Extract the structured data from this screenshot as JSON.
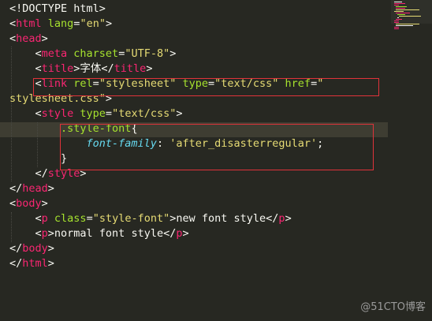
{
  "editor": {
    "lines": [
      [
        {
          "c": "p",
          "t": "<!DOCTYPE html>"
        }
      ],
      [
        {
          "c": "p",
          "t": "<"
        },
        {
          "c": "t",
          "t": "html"
        },
        {
          "c": "a",
          "t": " lang"
        },
        {
          "c": "p",
          "t": "="
        },
        {
          "c": "s",
          "t": "\"en\""
        },
        {
          "c": "p",
          "t": ">"
        }
      ],
      [
        {
          "c": "p",
          "t": "<"
        },
        {
          "c": "t",
          "t": "head"
        },
        {
          "c": "p",
          "t": ">"
        }
      ],
      [
        {
          "c": "p",
          "t": "    <"
        },
        {
          "c": "t",
          "t": "meta"
        },
        {
          "c": "a",
          "t": " charset"
        },
        {
          "c": "p",
          "t": "="
        },
        {
          "c": "s",
          "t": "\"UTF-8\""
        },
        {
          "c": "p",
          "t": ">"
        }
      ],
      [
        {
          "c": "p",
          "t": "    <"
        },
        {
          "c": "t",
          "t": "title"
        },
        {
          "c": "p",
          "t": ">字体</"
        },
        {
          "c": "t",
          "t": "title"
        },
        {
          "c": "p",
          "t": ">"
        }
      ],
      [
        {
          "c": "p",
          "t": "    <"
        },
        {
          "c": "t",
          "t": "link"
        },
        {
          "c": "a",
          "t": " rel"
        },
        {
          "c": "p",
          "t": "="
        },
        {
          "c": "s",
          "t": "\"stylesheet\""
        },
        {
          "c": "a",
          "t": " type"
        },
        {
          "c": "p",
          "t": "="
        },
        {
          "c": "s",
          "t": "\"text/css\""
        },
        {
          "c": "a",
          "t": " href"
        },
        {
          "c": "p",
          "t": "="
        },
        {
          "c": "s",
          "t": "\""
        }
      ],
      [
        {
          "c": "s",
          "t": "stylesheet.css\""
        },
        {
          "c": "p",
          "t": ">"
        }
      ],
      [
        {
          "c": "p",
          "t": "    <"
        },
        {
          "c": "t",
          "t": "style"
        },
        {
          "c": "a",
          "t": " type"
        },
        {
          "c": "p",
          "t": "="
        },
        {
          "c": "s",
          "t": "\"text/css\""
        },
        {
          "c": "p",
          "t": ">"
        }
      ],
      [
        {
          "c": "a",
          "t": "        .style-font"
        },
        {
          "c": "p",
          "t": "{"
        }
      ],
      [
        {
          "c": "pr",
          "t": "            font-family"
        },
        {
          "c": "p",
          "t": ": "
        },
        {
          "c": "s",
          "t": "'after_disasterregular'"
        },
        {
          "c": "p",
          "t": ";"
        }
      ],
      [
        {
          "c": "p",
          "t": "        }"
        }
      ],
      [
        {
          "c": "p",
          "t": "    </"
        },
        {
          "c": "t",
          "t": "style"
        },
        {
          "c": "p",
          "t": ">"
        }
      ],
      [
        {
          "c": "p",
          "t": "</"
        },
        {
          "c": "t",
          "t": "head"
        },
        {
          "c": "p",
          "t": ">"
        }
      ],
      [
        {
          "c": "p",
          "t": "<"
        },
        {
          "c": "t",
          "t": "body"
        },
        {
          "c": "p",
          "t": ">"
        }
      ],
      [
        {
          "c": "p",
          "t": "    <"
        },
        {
          "c": "t",
          "t": "p"
        },
        {
          "c": "a",
          "t": " class"
        },
        {
          "c": "p",
          "t": "="
        },
        {
          "c": "s",
          "t": "\"style-font\""
        },
        {
          "c": "p",
          "t": ">new font style</"
        },
        {
          "c": "t",
          "t": "p"
        },
        {
          "c": "p",
          "t": ">"
        }
      ],
      [
        {
          "c": "p",
          "t": "    <"
        },
        {
          "c": "t",
          "t": "p"
        },
        {
          "c": "p",
          "t": ">normal font style</"
        },
        {
          "c": "t",
          "t": "p"
        },
        {
          "c": "p",
          "t": ">"
        }
      ],
      [
        {
          "c": "p",
          "t": "</"
        },
        {
          "c": "t",
          "t": "body"
        },
        {
          "c": "p",
          "t": ">"
        }
      ],
      [
        {
          "c": "p",
          "t": "</"
        },
        {
          "c": "t",
          "t": "html"
        },
        {
          "c": "p",
          "t": ">"
        }
      ]
    ]
  },
  "colors": {
    "background": "#272822",
    "tag": "#f92672",
    "attribute": "#a6e22e",
    "string": "#e6db74",
    "property": "#66d9ef",
    "plain": "#f8f8f2",
    "annotation": "#e0333a"
  },
  "watermark": "@51CTO博客"
}
